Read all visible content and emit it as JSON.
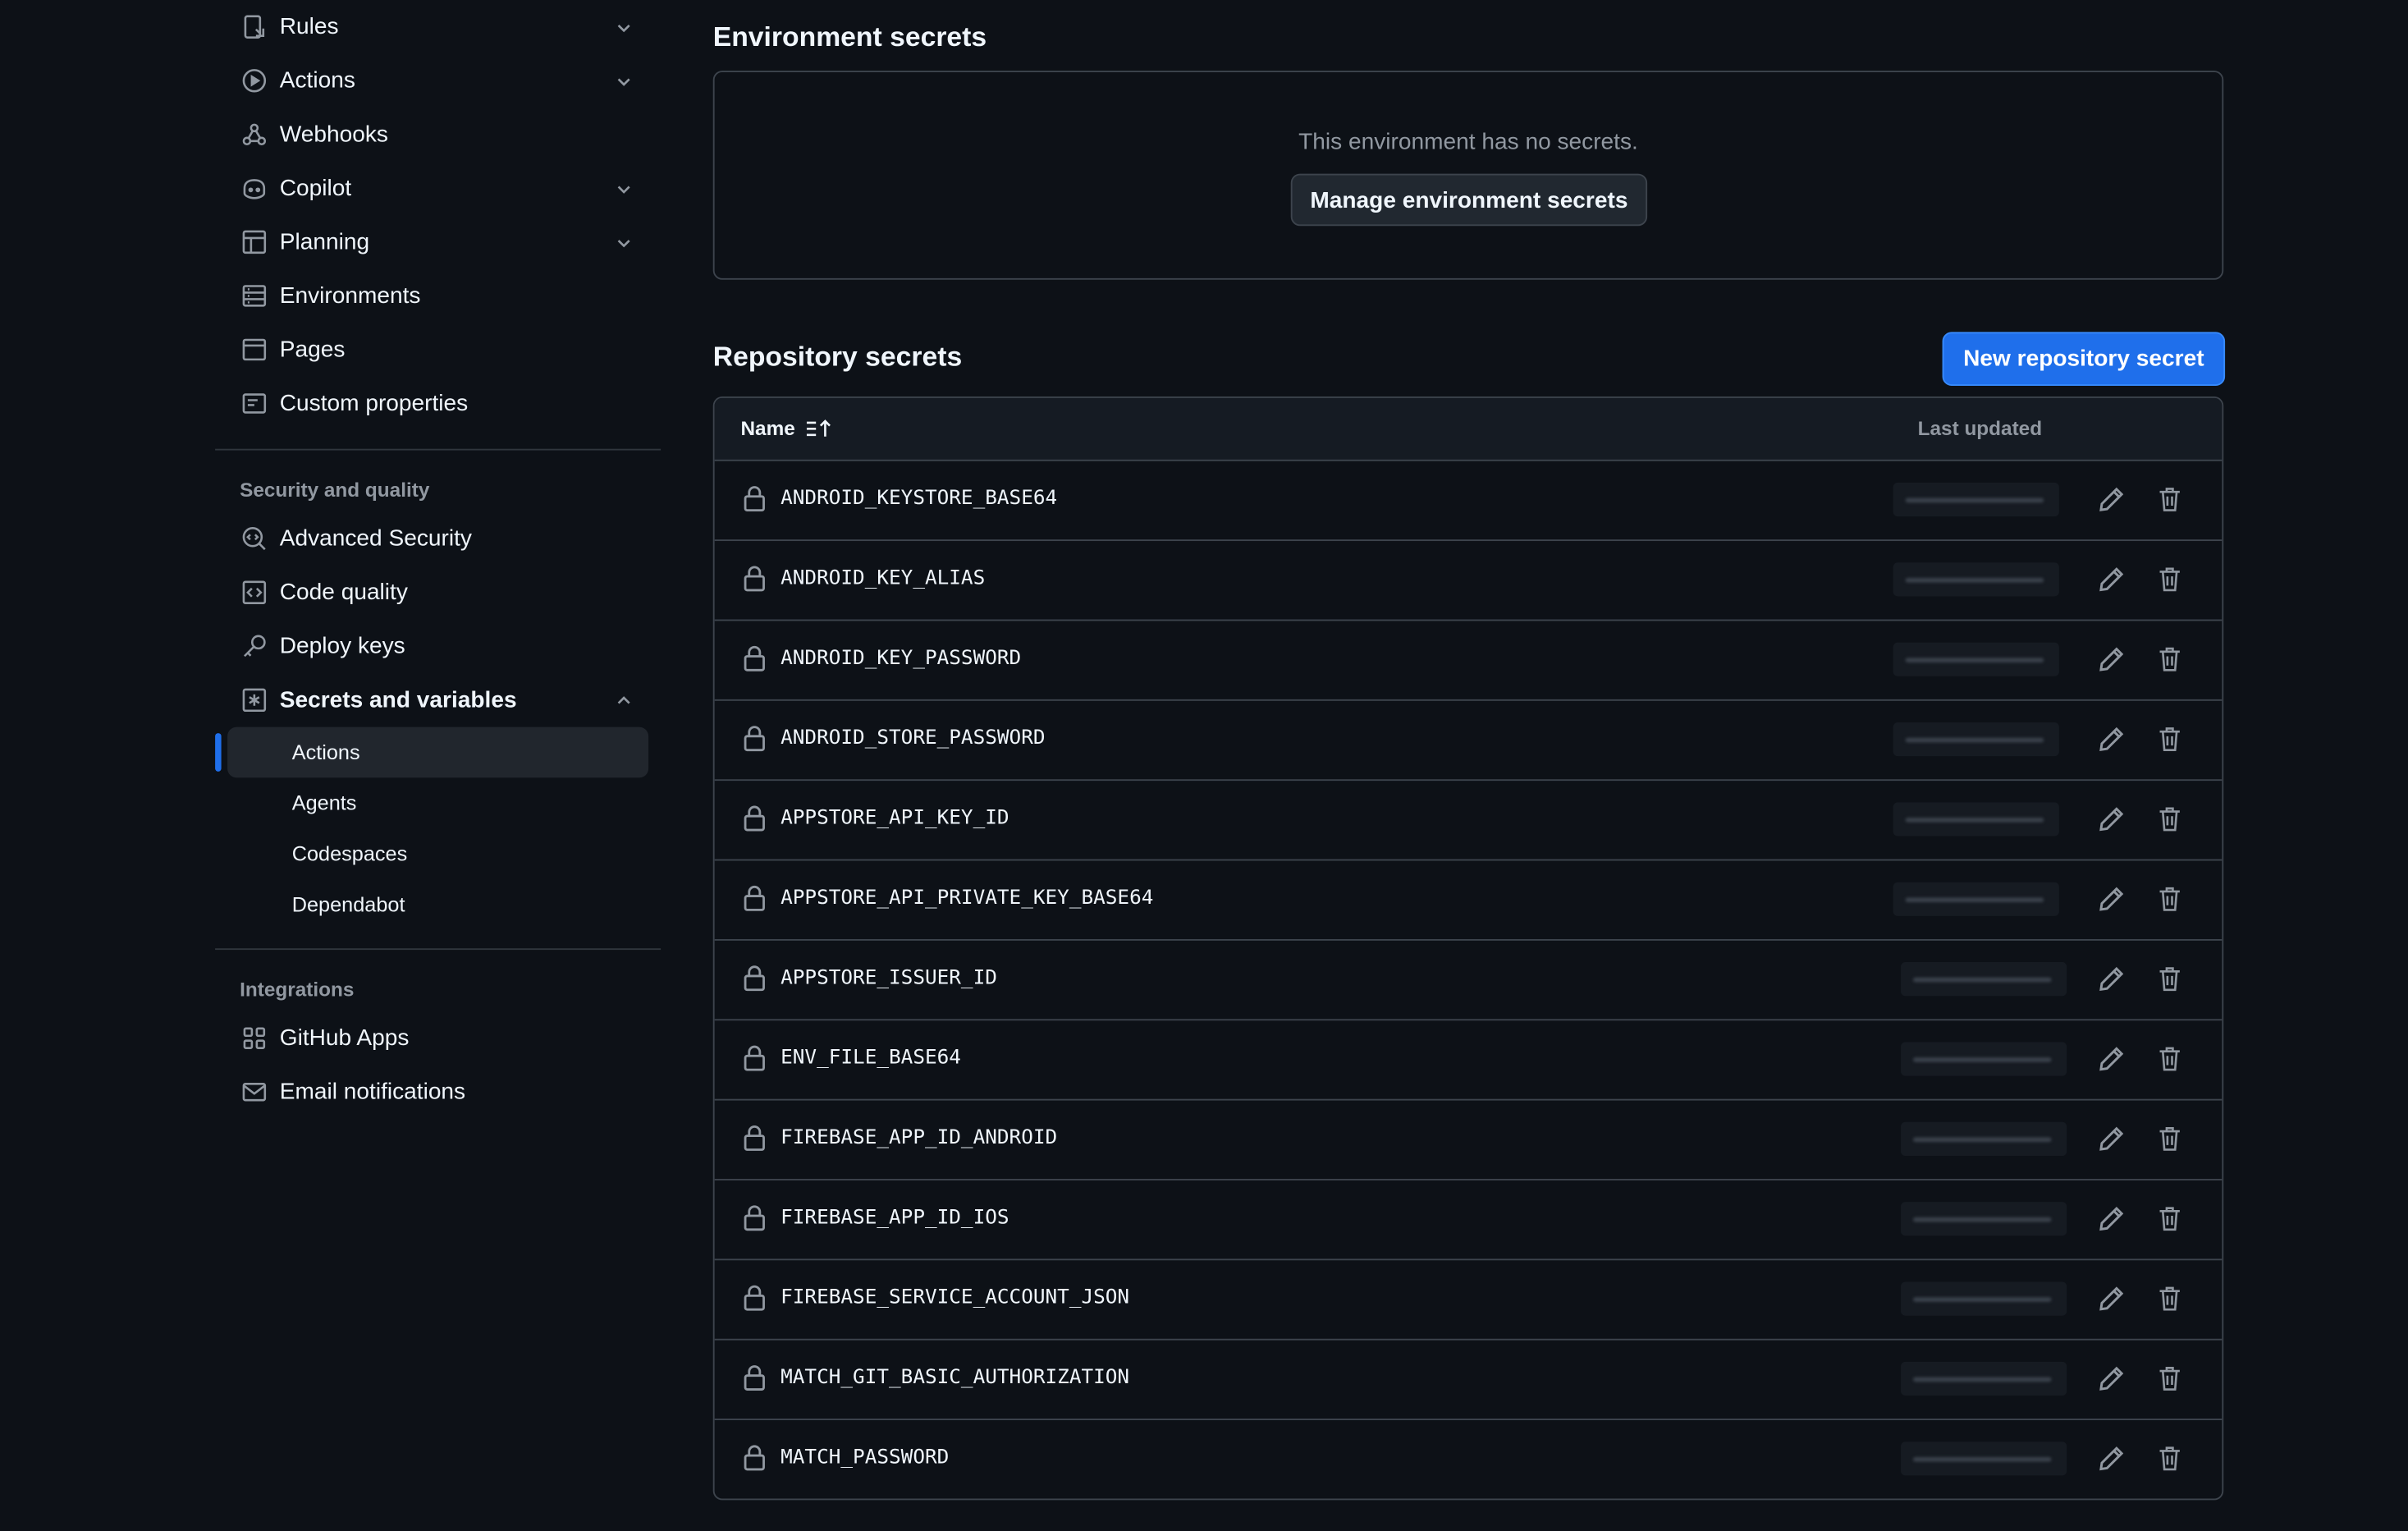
{
  "sidebar": {
    "top_items": [
      {
        "label": "Rules",
        "icon": "rules-icon",
        "expandable": true
      },
      {
        "label": "Actions",
        "icon": "play-icon",
        "expandable": true
      },
      {
        "label": "Webhooks",
        "icon": "webhook-icon",
        "expandable": false
      },
      {
        "label": "Copilot",
        "icon": "copilot-icon",
        "expandable": true
      },
      {
        "label": "Planning",
        "icon": "table-icon",
        "expandable": true
      },
      {
        "label": "Environments",
        "icon": "server-icon",
        "expandable": false
      },
      {
        "label": "Pages",
        "icon": "browser-icon",
        "expandable": false
      },
      {
        "label": "Custom properties",
        "icon": "note-icon",
        "expandable": false
      }
    ],
    "security_section": {
      "heading": "Security and quality",
      "items": [
        {
          "label": "Advanced Security",
          "icon": "codescan-icon"
        },
        {
          "label": "Code quality",
          "icon": "code-square-icon"
        },
        {
          "label": "Deploy keys",
          "icon": "key-icon"
        }
      ],
      "secrets": {
        "label": "Secrets and variables",
        "icon": "asterisk-icon",
        "expanded": true,
        "sub_items": [
          "Actions",
          "Agents",
          "Codespaces",
          "Dependabot"
        ],
        "active_sub_item": "Actions"
      }
    },
    "integrations_section": {
      "heading": "Integrations",
      "items": [
        {
          "label": "GitHub Apps",
          "icon": "apps-icon"
        },
        {
          "label": "Email notifications",
          "icon": "mail-icon"
        }
      ]
    }
  },
  "environment_secrets": {
    "title": "Environment secrets",
    "empty_message": "This environment has no secrets.",
    "manage_button": "Manage environment secrets"
  },
  "repository_secrets": {
    "title": "Repository secrets",
    "new_button": "New repository secret",
    "columns": {
      "name": "Name",
      "last_updated": "Last updated"
    },
    "secrets": [
      "ANDROID_KEYSTORE_BASE64",
      "ANDROID_KEY_ALIAS",
      "ANDROID_KEY_PASSWORD",
      "ANDROID_STORE_PASSWORD",
      "APPSTORE_API_KEY_ID",
      "APPSTORE_API_PRIVATE_KEY_BASE64",
      "APPSTORE_ISSUER_ID",
      "ENV_FILE_BASE64",
      "FIREBASE_APP_ID_ANDROID",
      "FIREBASE_APP_ID_IOS",
      "FIREBASE_SERVICE_ACCOUNT_JSON",
      "MATCH_GIT_BASIC_AUTHORIZATION",
      "MATCH_PASSWORD"
    ]
  },
  "colors": {
    "background": "#0d1117",
    "accent": "#1f6feb",
    "border": "#3d444d",
    "muted_text": "#9198a1"
  }
}
